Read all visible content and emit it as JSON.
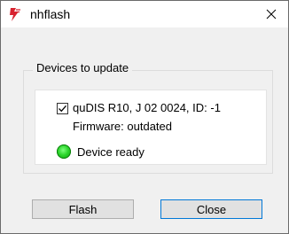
{
  "window": {
    "title": "nhflash",
    "icon": "nhflash-app-icon",
    "close_icon": "close-icon"
  },
  "group": {
    "legend": "Devices to update"
  },
  "device": {
    "checked": true,
    "name": "quDIS R10, J 02 0024, ID: -1",
    "firmware": "Firmware: outdated",
    "status_color": "#2ad42a",
    "status": "Device ready"
  },
  "buttons": {
    "flash": "Flash",
    "close": "Close"
  }
}
